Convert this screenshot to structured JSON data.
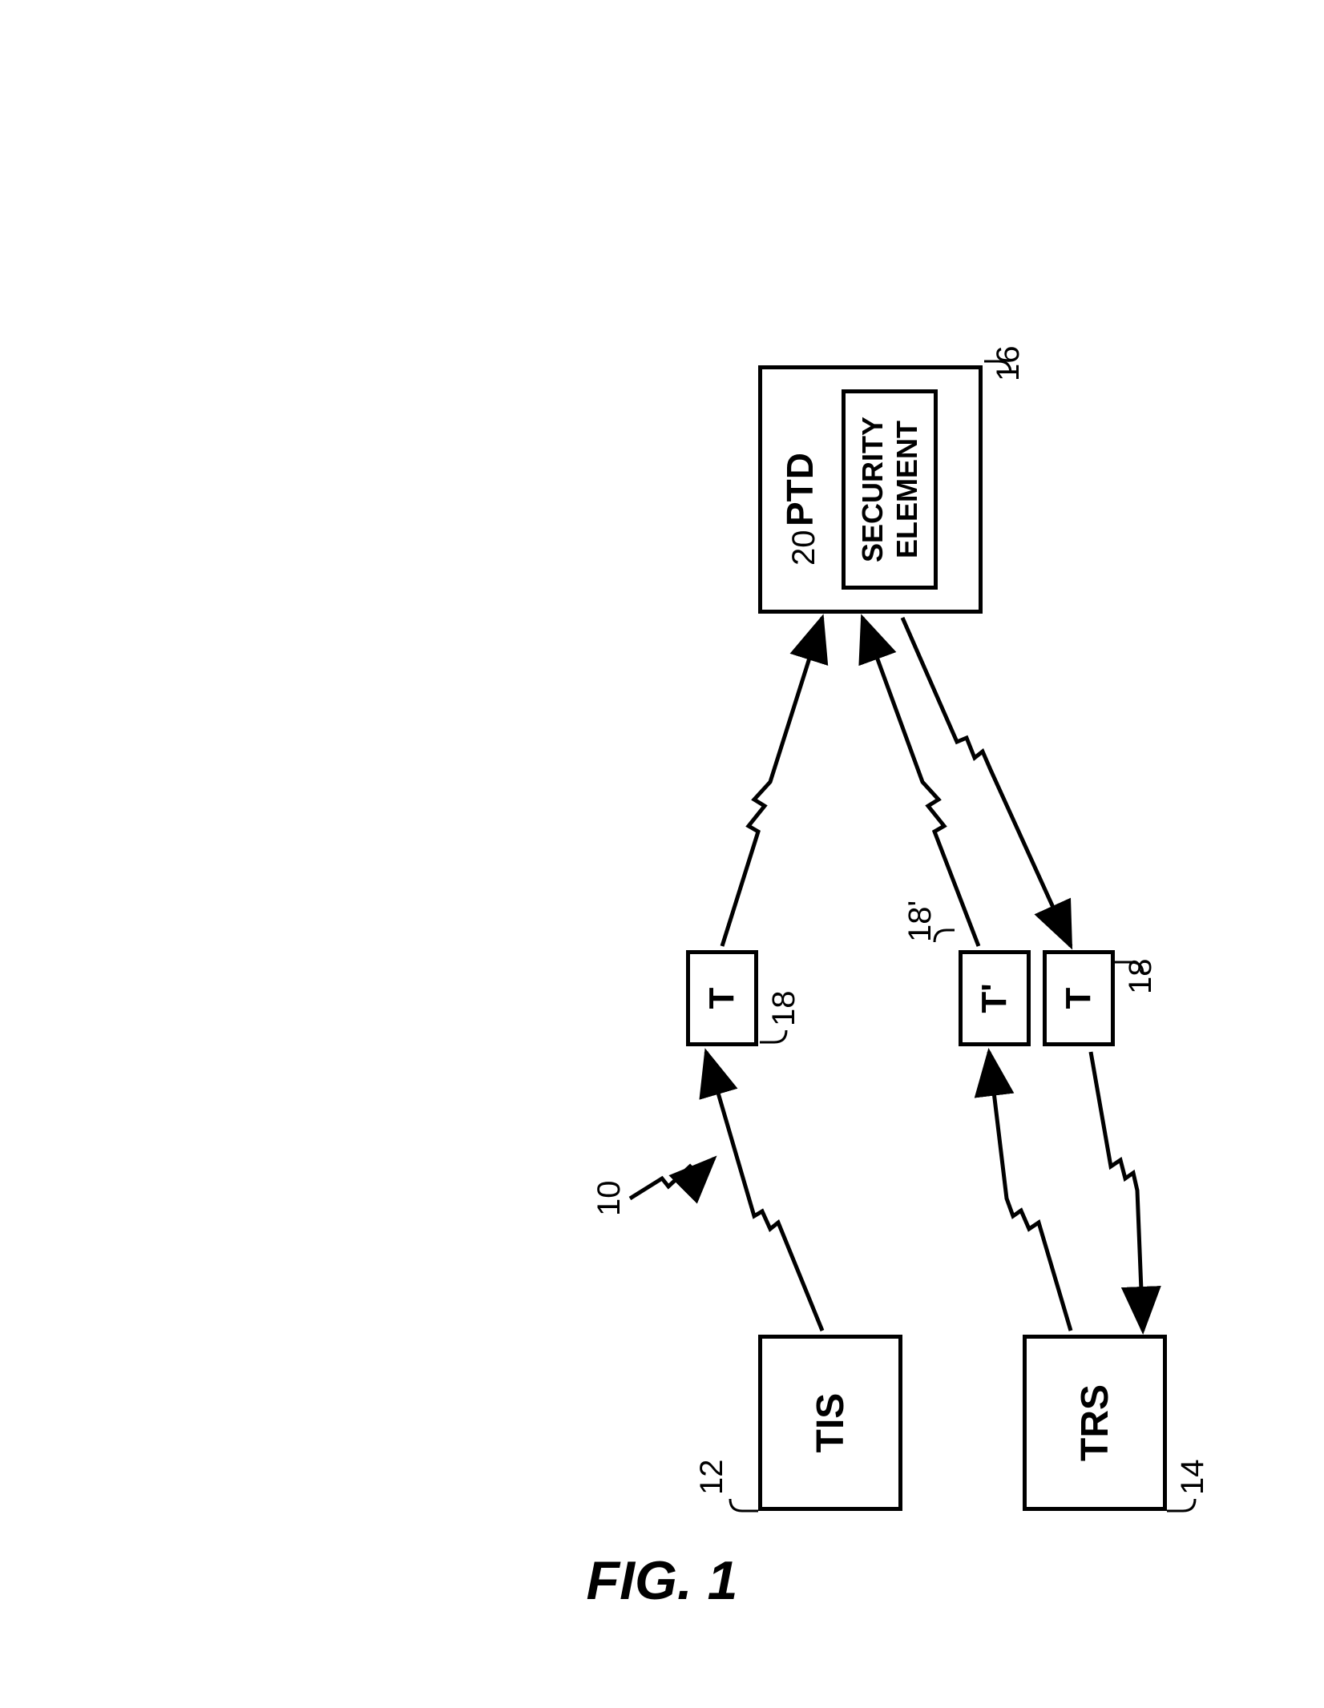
{
  "figure_label": "FIG. 1",
  "system_ref": "10",
  "boxes": {
    "tis": {
      "label": "TIS",
      "ref": "12"
    },
    "trs": {
      "label": "TRS",
      "ref": "14"
    },
    "t_top": {
      "label": "T",
      "ref": "18"
    },
    "t_prime": {
      "label": "T'",
      "ref": "18'"
    },
    "t_bottom": {
      "label": "T",
      "ref": "18"
    },
    "ptd": {
      "label": "PTD",
      "ref": "16"
    },
    "security": {
      "label": "SECURITY ELEMENT",
      "ref": "20"
    }
  }
}
